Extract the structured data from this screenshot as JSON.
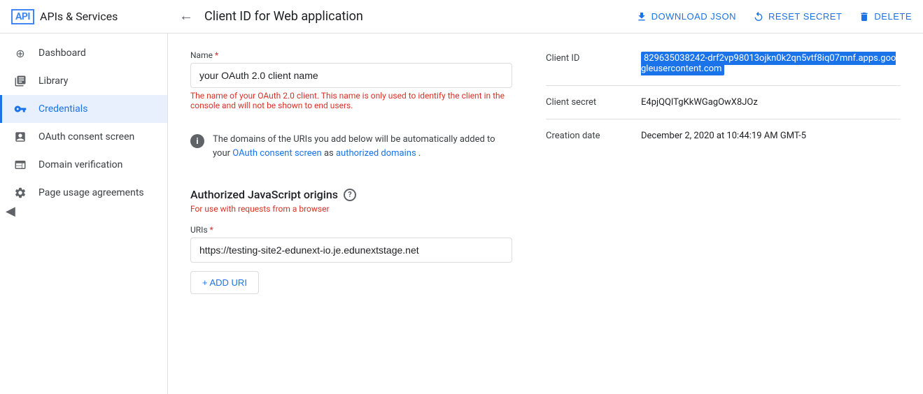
{
  "topBar": {
    "logo": "API",
    "serviceTitle": "APIs & Services",
    "backArrow": "←",
    "pageTitle": "Client ID for Web application",
    "actions": [
      {
        "id": "download-json",
        "label": "DOWNLOAD JSON",
        "icon": "download"
      },
      {
        "id": "reset-secret",
        "label": "RESET SECRET",
        "icon": "reset"
      },
      {
        "id": "delete",
        "label": "DELETE",
        "icon": "delete"
      }
    ]
  },
  "sidebar": {
    "items": [
      {
        "id": "dashboard",
        "label": "Dashboard",
        "icon": "⊕"
      },
      {
        "id": "library",
        "label": "Library",
        "icon": "≡"
      },
      {
        "id": "credentials",
        "label": "Credentials",
        "icon": "🔑",
        "active": true
      },
      {
        "id": "oauth-consent",
        "label": "OAuth consent screen",
        "icon": "☰"
      },
      {
        "id": "domain-verification",
        "label": "Domain verification",
        "icon": "□"
      },
      {
        "id": "page-usage",
        "label": "Page usage agreements",
        "icon": "⚙"
      }
    ],
    "collapseLabel": "◀"
  },
  "form": {
    "nameLabel": "Name",
    "nameRequired": "*",
    "namePlaceholder": "your OAuth 2.0 client name",
    "nameValue": "your OAuth 2.0 client name",
    "helperText": "The name of your OAuth 2.0 client. This name is only used to identify the client in the console and will not be shown to end users.",
    "infoText": "The domains of the URIs you add below will be automatically added to your ",
    "infoLinkOAuth": "OAuth consent screen",
    "infoTextMid": " as ",
    "infoLinkAuth": "authorized domains",
    "infoTextEnd": ".",
    "jsOriginsTitle": "Authorized JavaScript origins",
    "jsOriginsSubtext": "For use with requests from a browser",
    "urisLabel": "URIs",
    "urisRequired": "*",
    "uriValue": "https://testing-site2-edunext-io.je.edunextstage.net",
    "addUriLabel": "+ ADD URI"
  },
  "clientInfo": {
    "clientIdLabel": "Client ID",
    "clientIdValue": "829635038242-drf2vp98013ojkn0k2qn5vtf8iq07mnf.apps.googleusercontent.com",
    "clientSecretLabel": "Client secret",
    "clientSecretValue": "E4pjQQlTgKkWGagOwX8JOz",
    "creationDateLabel": "Creation date",
    "creationDateValue": "December 2, 2020 at 10:44:19 AM GMT-5"
  }
}
